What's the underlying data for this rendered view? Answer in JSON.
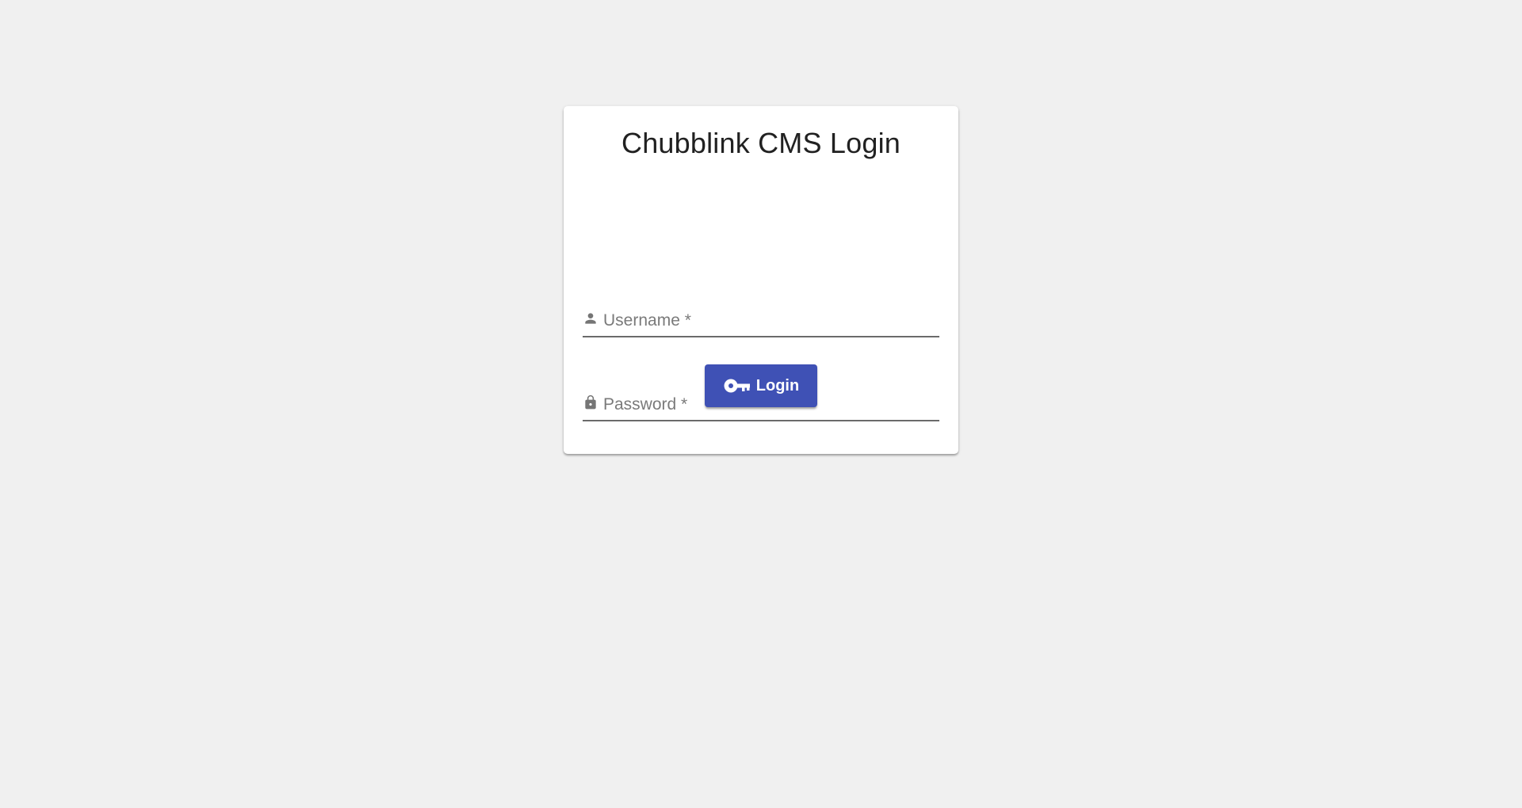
{
  "login_card": {
    "title": "Chubblink CMS Login",
    "username": {
      "placeholder": "Username *",
      "value": "",
      "icon": "person-icon"
    },
    "password": {
      "placeholder": "Password *",
      "value": "",
      "icon": "lock-icon"
    },
    "login_button": {
      "label": "Login",
      "icon": "key-icon"
    }
  },
  "colors": {
    "page_background": "#f0f0f0",
    "card_background": "#ffffff",
    "primary": "#3f51b5",
    "field_underline": "#6b6b6b",
    "placeholder_text": "#7a7a7a",
    "title_text": "#212121"
  }
}
